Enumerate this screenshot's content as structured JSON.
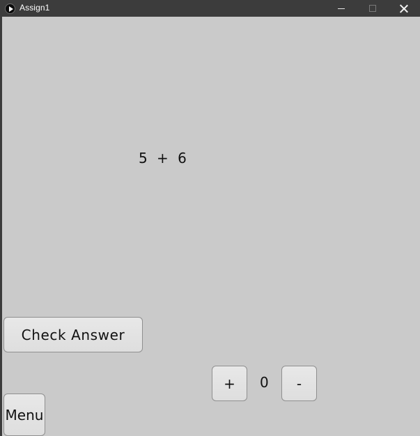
{
  "window": {
    "title": "Assign1",
    "app_icon": "play-icon",
    "controls": {
      "minimize_icon": "minimize-icon",
      "maximize_icon": "maximize-icon",
      "close_icon": "close-icon"
    }
  },
  "problem": {
    "equation": "5  +  6"
  },
  "buttons": {
    "check_answer": "Check Answer",
    "increment": "+",
    "decrement": "-",
    "menu": "Menu"
  },
  "counter": {
    "value": "0"
  },
  "colors": {
    "titlebar": "#3c3c3c",
    "content_bg": "#cacaca",
    "button_bg": "#e5e5e5",
    "button_border": "#8f8f8f"
  }
}
